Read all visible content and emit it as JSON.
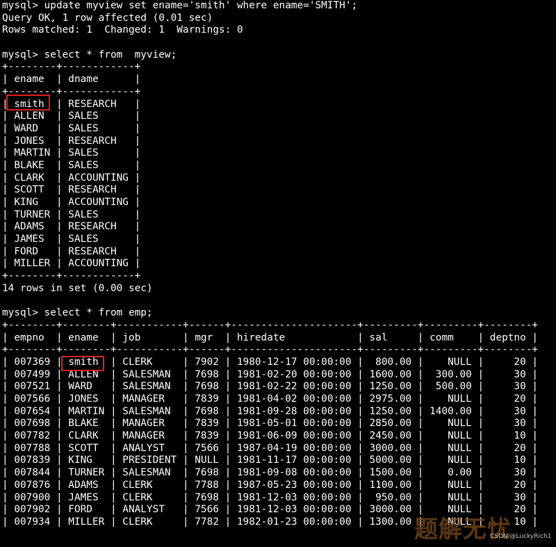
{
  "terminal": {
    "lines": [
      "mysql> update myview set ename='smith' where ename='SMITH';",
      "Query OK, 1 row affected (0.01 sec)",
      "Rows matched: 1  Changed: 1  Warnings: 0",
      "",
      "mysql> select * from  myview;",
      "+--------+------------+",
      "| ename  | dname      |",
      "+--------+------------+",
      "| smith  | RESEARCH   |",
      "| ALLEN  | SALES      |",
      "| WARD   | SALES      |",
      "| JONES  | RESEARCH   |",
      "| MARTIN | SALES      |",
      "| BLAKE  | SALES      |",
      "| CLARK  | ACCOUNTING |",
      "| SCOTT  | RESEARCH   |",
      "| KING   | ACCOUNTING |",
      "| TURNER | SALES      |",
      "| ADAMS  | RESEARCH   |",
      "| JAMES  | SALES      |",
      "| FORD   | RESEARCH   |",
      "| MILLER | ACCOUNTING |",
      "+--------+------------+",
      "14 rows in set (0.00 sec)",
      "",
      "mysql> select * from emp;",
      "+--------+--------+-----------+------+---------------------+---------+---------+--------+",
      "| empno  | ename  | job       | mgr  | hiredate            | sal     | comm    | deptno |",
      "+--------+--------+-----------+------+---------------------+---------+---------+--------+",
      "| 007369 | smith  | CLERK     | 7902 | 1980-12-17 00:00:00 |  800.00 |    NULL |     20 |",
      "| 007499 | ALLEN  | SALESMAN  | 7698 | 1981-02-20 00:00:00 | 1600.00 |  300.00 |     30 |",
      "| 007521 | WARD   | SALESMAN  | 7698 | 1981-02-22 00:00:00 | 1250.00 |  500.00 |     30 |",
      "| 007566 | JONES  | MANAGER   | 7839 | 1981-04-02 00:00:00 | 2975.00 |    NULL |     20 |",
      "| 007654 | MARTIN | SALESMAN  | 7698 | 1981-09-28 00:00:00 | 1250.00 | 1400.00 |     30 |",
      "| 007698 | BLAKE  | MANAGER   | 7839 | 1981-05-01 00:00:00 | 2850.00 |    NULL |     30 |",
      "| 007782 | CLARK  | MANAGER   | 7839 | 1981-06-09 00:00:00 | 2450.00 |    NULL |     10 |",
      "| 007788 | SCOTT  | ANALYST   | 7566 | 1987-04-19 00:00:00 | 3000.00 |    NULL |     20 |",
      "| 007839 | KING   | PRESIDENT | NULL | 1981-11-17 00:00:00 | 5000.00 |    NULL |     10 |",
      "| 007844 | TURNER | SALESMAN  | 7698 | 1981-09-08 00:00:00 | 1500.00 |    0.00 |     30 |",
      "| 007876 | ADAMS  | CLERK     | 7788 | 1987-05-23 00:00:00 | 1100.00 |    NULL |     20 |",
      "| 007900 | JAMES  | CLERK     | 7698 | 1981-12-03 00:00:00 |  950.00 |    NULL |     30 |",
      "| 007902 | FORD   | ANALYST   | 7566 | 1981-12-03 00:00:00 | 3000.00 |    NULL |     20 |",
      "| 007934 | MILLER | CLERK     | 7782 | 1982-01-23 00:00:00 | 1300.00 |    NULL |     10 |"
    ]
  },
  "watermark": {
    "text": "题解无忧",
    "credit": "CSDN @LuckyRich1"
  },
  "colors": {
    "background": "#000000",
    "text": "#ffffff",
    "highlight_box": "#e02020"
  }
}
